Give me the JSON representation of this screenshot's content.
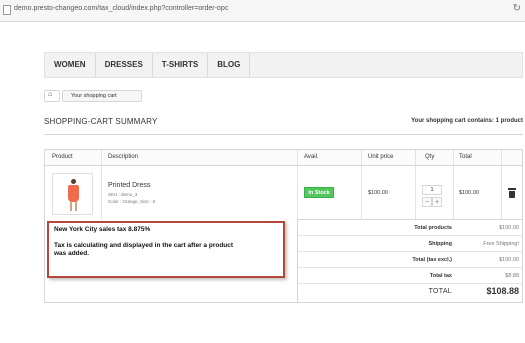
{
  "browser": {
    "url": "demo.presto-changeo.com/tax_cloud/index.php?controller=order-opc"
  },
  "nav": {
    "items": [
      "WOMEN",
      "DRESSES",
      "T-SHIRTS",
      "BLOG"
    ]
  },
  "breadcrumb": {
    "current": "Your shopping cart"
  },
  "summary": {
    "title": "SHOPPING-CART SUMMARY",
    "count_text": "Your shopping cart contains: 1 product"
  },
  "table": {
    "headers": [
      "Product",
      "Description",
      "Avail.",
      "Unit price",
      "Qty",
      "Total"
    ]
  },
  "item": {
    "name": "Printed Dress",
    "sku": "SKU : demo_3",
    "attributes": "Color : Orange, Size : S",
    "availability": "In Stock",
    "unit_price": "$100.00",
    "qty": "1",
    "total": "$100.00"
  },
  "totals": [
    {
      "label": "Total products",
      "value": "$100.00"
    },
    {
      "label": "Shipping",
      "value": "Free Shipping!"
    },
    {
      "label": "Total (tax excl.)",
      "value": "$100.00"
    },
    {
      "label": "Total tax",
      "value": "$8.88"
    },
    {
      "label": "TOTAL",
      "value": "$108.88"
    }
  ],
  "annotation": {
    "line1": "New York City sales tax 8.875%",
    "line2": "Tax is calculating and displayed in the cart after a product",
    "line3": "was added."
  },
  "colors": {
    "in_stock": "#55c65e",
    "annotation_border": "#b5463a"
  },
  "icons": {
    "home": "home-icon",
    "delete": "trash-icon",
    "reload": "reload-icon"
  }
}
